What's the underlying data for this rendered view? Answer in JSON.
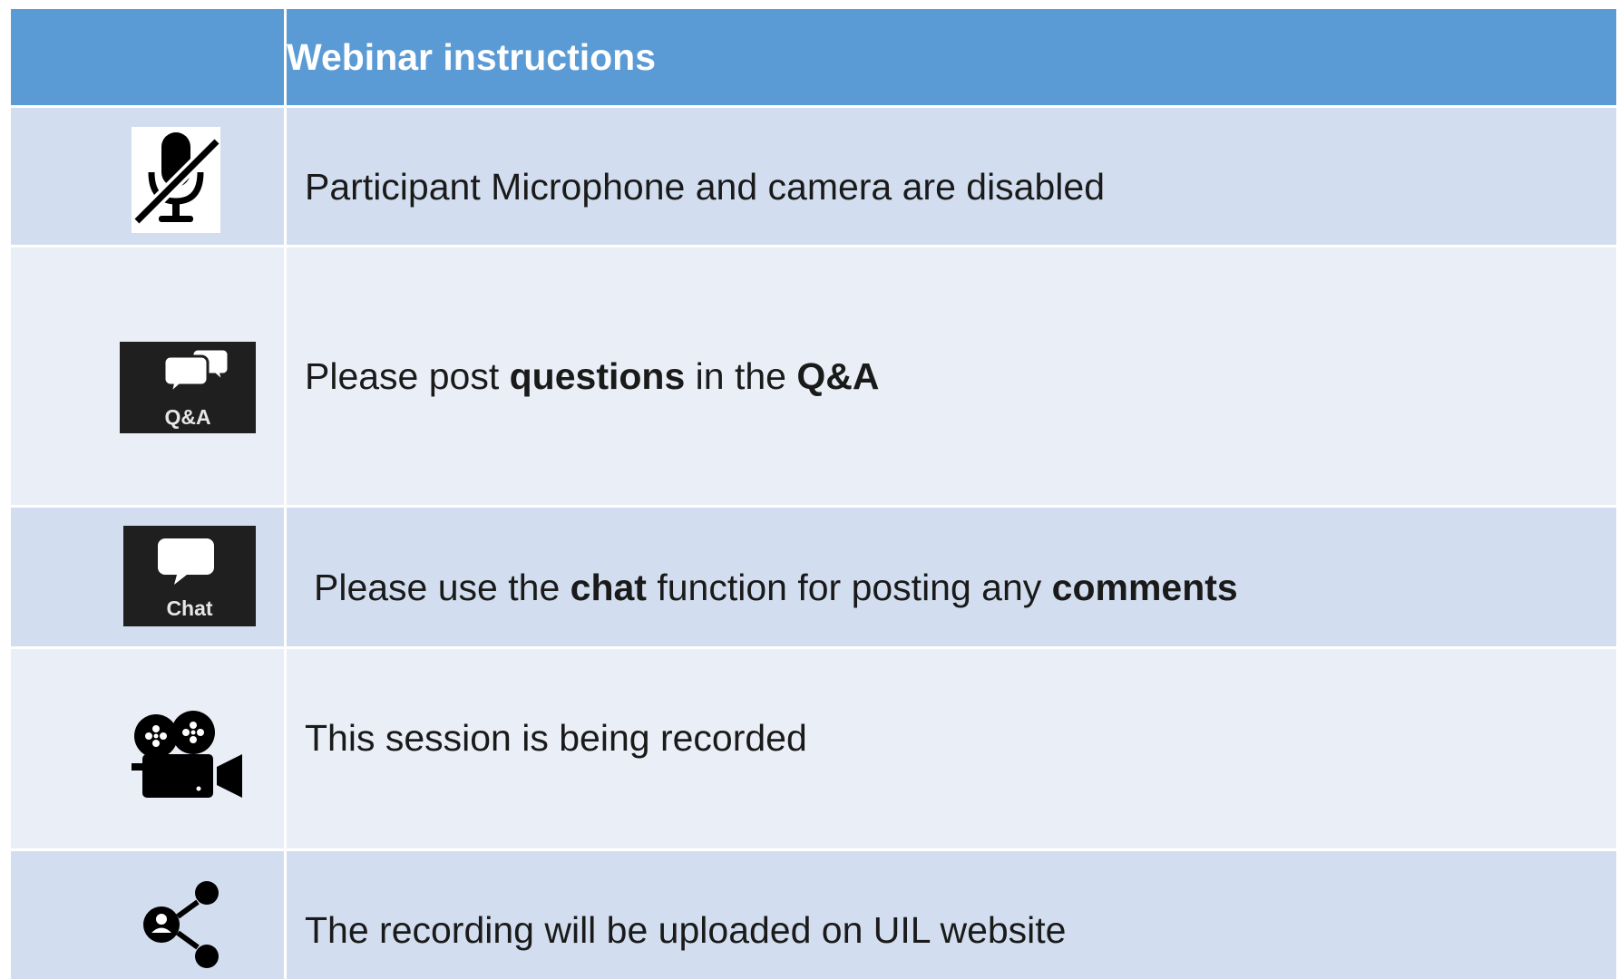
{
  "header": {
    "title": "Webinar instructions"
  },
  "rows": [
    {
      "icon": "microphone-off-icon",
      "text": "Participant Microphone  and camera are  disabled"
    },
    {
      "icon": "qa-icon",
      "icon_label": "Q&A",
      "text_parts": [
        "Please post ",
        "questions",
        " in the ",
        "Q&A"
      ]
    },
    {
      "icon": "chat-icon",
      "icon_label": "Chat",
      "text_parts": [
        "Please use the ",
        "chat",
        " function for posting any ",
        "comments"
      ]
    },
    {
      "icon": "movie-camera-icon",
      "text": "This session is being recorded"
    },
    {
      "icon": "share-icon",
      "text": "The recording will be uploaded on UIL website"
    }
  ],
  "colors": {
    "header_bg": "#5b9bd5",
    "row_dark": "#d2deef",
    "row_light": "#eaeff7",
    "icon_tile_bg": "#1f1f1f"
  }
}
